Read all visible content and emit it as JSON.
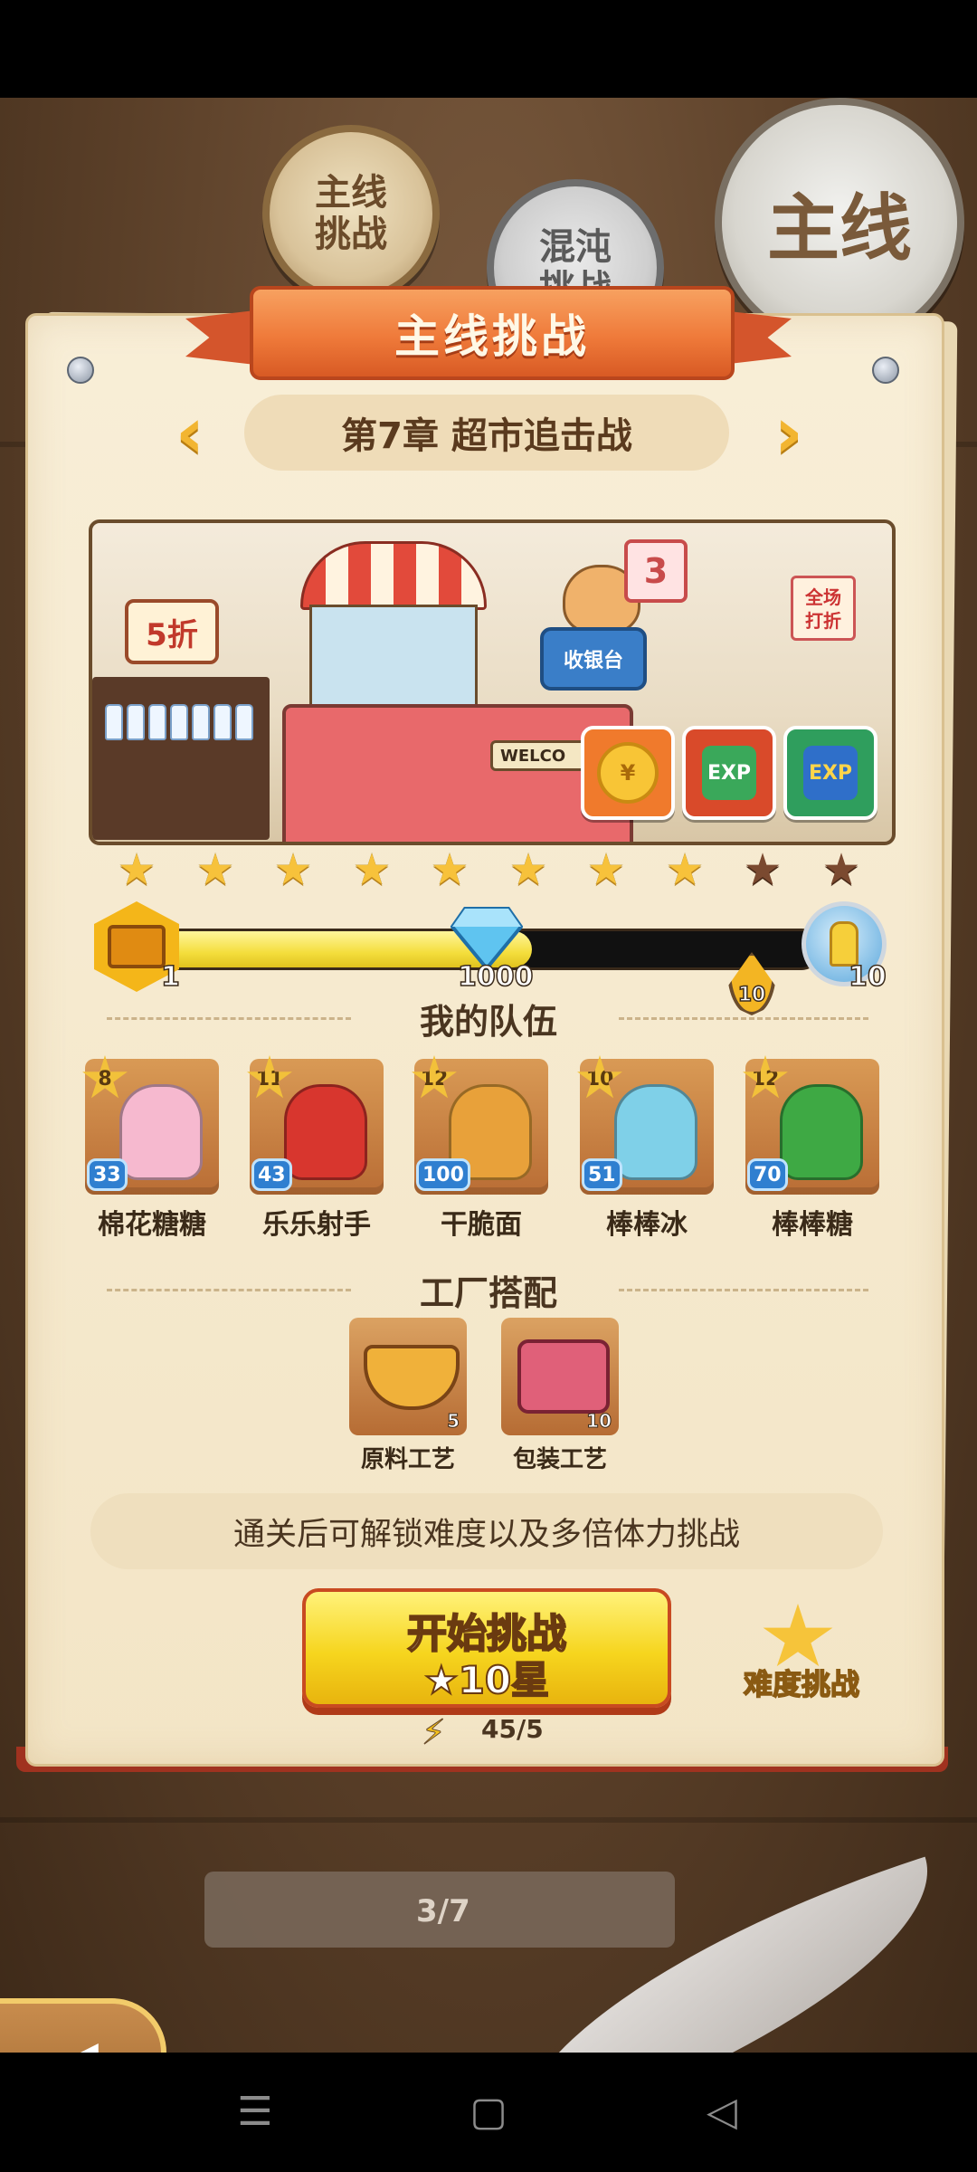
{
  "modes": {
    "main_line": "主线\n挑战",
    "chaos": "混沌\n挑战",
    "big_badge": "主线"
  },
  "header": {
    "title": "主线挑战"
  },
  "chapter": {
    "label": "第7章 超市追击战",
    "prev_icon": "chevron-left-icon",
    "next_icon": "chevron-right-icon"
  },
  "preview": {
    "sale_sign": "5折",
    "number_sign": "3",
    "cashier_sign": "收银台",
    "discount_sign": "全场\n打折",
    "welcome_sign": "WELCO",
    "rewards": [
      {
        "name": "coin-reward",
        "icon": "coin-icon",
        "text": "¥"
      },
      {
        "name": "exp-reward-red",
        "icon": "exp-icon",
        "text": "EXP"
      },
      {
        "name": "exp-reward-green",
        "icon": "exp-icon",
        "text": "EXP"
      }
    ]
  },
  "stars": {
    "total": 10,
    "earned": 8
  },
  "progress": {
    "fraction": 0.57,
    "start_label": "1",
    "mid_label": "1000",
    "milestone_label": "10",
    "end_label": "10"
  },
  "team": {
    "title": "我的队伍",
    "members": [
      {
        "name": "棉花糖糖",
        "star_level": "8",
        "level": "33",
        "color": "#f6b9cf"
      },
      {
        "name": "乐乐射手",
        "star_level": "11",
        "level": "43",
        "color": "#d8362e"
      },
      {
        "name": "干脆面",
        "star_level": "12",
        "level": "100",
        "color": "#e8a13a"
      },
      {
        "name": "棒棒冰",
        "star_level": "10",
        "level": "51",
        "color": "#7fd0e8"
      },
      {
        "name": "棒棒糖",
        "star_level": "12",
        "level": "70",
        "color": "#3ea944"
      }
    ]
  },
  "factory": {
    "title": "工厂搭配",
    "items": [
      {
        "name": "原料工艺",
        "count": "5",
        "color": "#f0b13a"
      },
      {
        "name": "包装工艺",
        "count": "10",
        "color": "#e06079"
      }
    ]
  },
  "notice": "通关后可解锁难度以及多倍体力挑战",
  "start": {
    "label": "开始挑战",
    "cost": "★10星"
  },
  "energy": "45/5",
  "difficulty": "难度挑战",
  "pager": "3/7",
  "colors": {
    "accent": "#ef7a3a",
    "button": "#f6d51e",
    "card": "#f8eed7"
  }
}
